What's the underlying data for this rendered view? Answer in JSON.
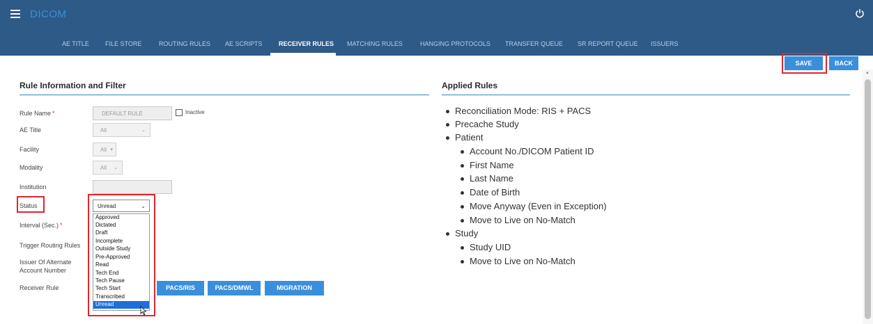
{
  "app": {
    "title": "DICOM"
  },
  "nav": {
    "items": [
      {
        "label": "AE TITLE"
      },
      {
        "label": "FILE STORE"
      },
      {
        "label": "ROUTING RULES"
      },
      {
        "label": "AE SCRIPTS"
      },
      {
        "label": "RECEIVER RULES"
      },
      {
        "label": "MATCHING RULES"
      },
      {
        "label": "HANGING PROTOCOLS"
      },
      {
        "label": "TRANSFER QUEUE"
      },
      {
        "label": "SR REPORT QUEUE"
      },
      {
        "label": "ISSUERS"
      }
    ],
    "active": "RECEIVER RULES"
  },
  "toolbar": {
    "save_label": "SAVE",
    "back_label": "BACK"
  },
  "form": {
    "section_title": "Rule Information and Filter",
    "rule_name": {
      "label": "Rule Name",
      "required_mark": "*",
      "value": "DEFAULT RULE"
    },
    "inactive_label": "Inactive",
    "ae_title": {
      "label": "AE Title",
      "value": "All"
    },
    "facility": {
      "label": "Facility",
      "value": "All"
    },
    "modality": {
      "label": "Modality",
      "value": "All"
    },
    "institution": {
      "label": "Institution",
      "value": ""
    },
    "status": {
      "label": "Status",
      "value": "Unread"
    },
    "interval": {
      "label": "Interval (Sec.)",
      "required_mark": "*"
    },
    "trigger_label": "Trigger Routing Rules",
    "issuer_label_line1": "Issuer Of Alternate",
    "issuer_label_line2": "Account Number",
    "receiver_rule_label": "Receiver Rule",
    "receiver_buttons": [
      "PACS/RIS",
      "PACS/DMWL",
      "MIGRATION"
    ]
  },
  "status_options": [
    "Approved",
    "Dictated",
    "Draft",
    "Incomplete",
    "Outside Study",
    "Pre-Approved",
    "Read",
    "Tech End",
    "Tech Pause",
    "Tech Start",
    "Transcribed",
    "Unread"
  ],
  "status_selected": "Unread",
  "applied": {
    "title": "Applied Rules",
    "rules": [
      {
        "text": "Reconciliation Mode: RIS + PACS",
        "level": 0
      },
      {
        "text": "Precache Study",
        "level": 0
      },
      {
        "text": "Patient",
        "level": 0
      },
      {
        "text": "Account No./DICOM Patient ID",
        "level": 1
      },
      {
        "text": "First Name",
        "level": 1
      },
      {
        "text": "Last Name",
        "level": 1
      },
      {
        "text": "Date of Birth",
        "level": 1
      },
      {
        "text": "Move Anyway (Even in Exception)",
        "level": 1
      },
      {
        "text": "Move to Live on No-Match",
        "level": 1
      },
      {
        "text": "Study",
        "level": 0
      },
      {
        "text": "Study UID",
        "level": 1
      },
      {
        "text": "Move to Live on No-Match",
        "level": 1
      }
    ]
  },
  "colors": {
    "header": "#2e5a87",
    "accent": "#3a8fdc",
    "highlight": "#e0262b",
    "dropdown_selected": "#1e6fd9"
  },
  "icons": [
    "menu-icon",
    "power-icon",
    "chevron-down-icon",
    "mouse-cursor-icon"
  ]
}
